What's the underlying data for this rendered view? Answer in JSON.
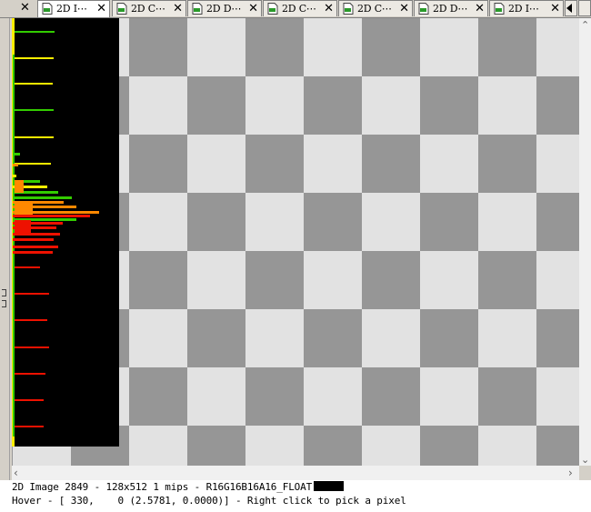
{
  "tabs": [
    {
      "label": "2D I⋯",
      "active": true
    },
    {
      "label": "2D C⋯",
      "active": false
    },
    {
      "label": "2D D⋯",
      "active": false
    },
    {
      "label": "2D C⋯",
      "active": false
    },
    {
      "label": "2D C⋯",
      "active": false
    },
    {
      "label": "2D D⋯",
      "active": false
    },
    {
      "label": "2D I⋯",
      "active": false
    }
  ],
  "tab_close_glyph": "✕",
  "status": {
    "image_info": "2D Image 2849 - 128x512 1 mips - R16G16B16A16_FLOAT",
    "hover_info": "Hover - [ 330,    0 (2.5781, 0.0000)] - Right click to pick a pixel"
  },
  "colors": {
    "checker_dark": "#969696",
    "checker_light": "#e2e2e2",
    "image_background": "#000000",
    "series_green": "#33cc00",
    "series_yellow": "#ffee00",
    "series_orange": "#ff8800",
    "series_red": "#ee1100"
  }
}
